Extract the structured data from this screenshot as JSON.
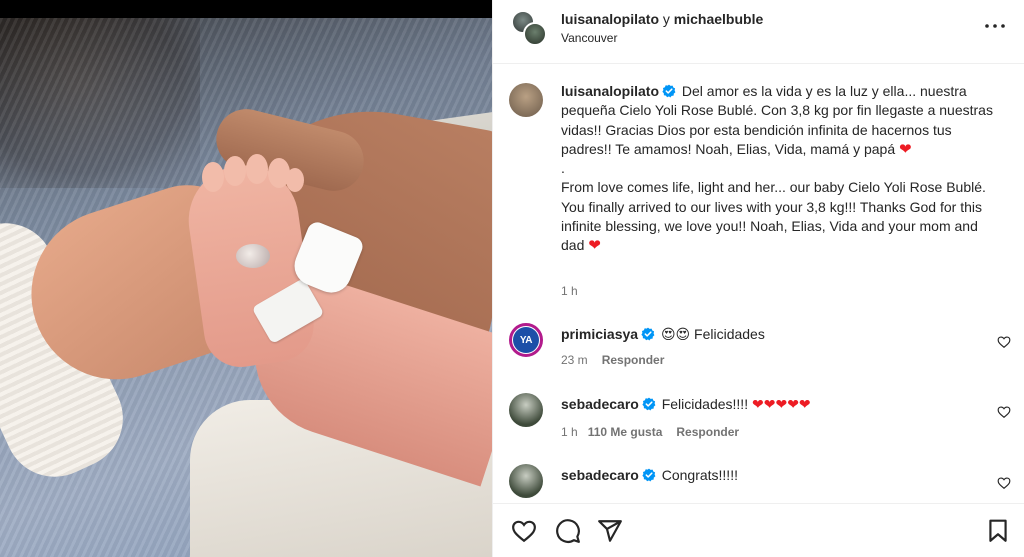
{
  "post": {
    "header": {
      "user1": "luisanalopilato",
      "connector": "y",
      "user2": "michaelbuble",
      "location": "Vancouver"
    },
    "caption": {
      "username": "luisanalopilato",
      "text_es": "Del amor es la vida y es la luz y ella... nuestra pequeña Cielo Yoli Rose Bublé. Con 3,8 kg por fin llegaste a nuestras vidas!! Gracias Dios por esta bendición infinita de hacernos tus padres!! Te amamos! Noah, Elias, Vida, mamá y papá",
      "dot": ".",
      "text_en": "From love comes life, light and her... our baby Cielo Yoli Rose Bublé. You finally arrived to our lives with your 3,8 kg!!! Thanks God for this infinite blessing, we love you!! Noah, Elias, Vida and your mom and dad",
      "time": "1 h"
    },
    "comments": [
      {
        "username": "primiciasya",
        "avatar_text": "YA",
        "text": "😍😍 Felicidades",
        "time": "23 m",
        "likes": "",
        "reply": "Responder"
      },
      {
        "username": "sebadecaro",
        "text": "Felicidades!!!! ❤❤❤❤❤",
        "time": "1 h",
        "likes": "110 Me gusta",
        "reply": "Responder"
      },
      {
        "username": "sebadecaro",
        "text": "Congrats!!!!!",
        "time": "",
        "likes": "",
        "reply": ""
      }
    ]
  },
  "colors": {
    "verified": "#0095f6",
    "heart": "#ed1c24",
    "muted": "#737373",
    "border": "#efefef"
  },
  "icons": [
    "verified-badge-icon",
    "more-options-icon",
    "heart-outline-icon",
    "comment-icon",
    "share-icon",
    "bookmark-icon"
  ]
}
